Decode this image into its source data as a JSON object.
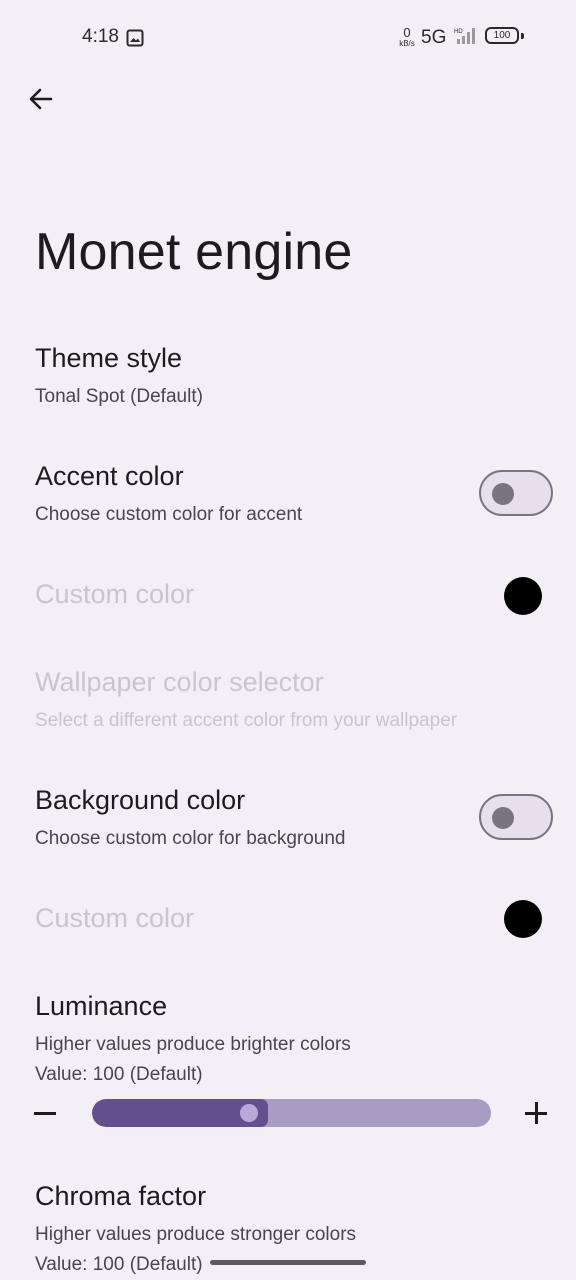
{
  "status_bar": {
    "time": "4:18",
    "net_speed": "0",
    "net_unit": "kB/s",
    "network": "5G",
    "signal_label": "HD",
    "battery": "100"
  },
  "page_title": "Monet engine",
  "prefs": {
    "theme_style": {
      "title": "Theme style",
      "summary": "Tonal Spot (Default)"
    },
    "accent_color": {
      "title": "Accent color",
      "summary": "Choose custom color for accent",
      "enabled": false
    },
    "custom_color_1": {
      "title": "Custom color",
      "color": "#000000"
    },
    "wallpaper_selector": {
      "title": "Wallpaper color selector",
      "summary": "Select a different accent color from your wallpaper"
    },
    "background_color": {
      "title": "Background color",
      "summary": "Choose custom color for background",
      "enabled": false
    },
    "custom_color_2": {
      "title": "Custom color",
      "color": "#000000"
    },
    "luminance": {
      "title": "Luminance",
      "summary": "Higher values produce brighter colors",
      "value": "Value: 100 (Default)",
      "level": 0.4
    },
    "chroma": {
      "title": "Chroma factor",
      "summary": "Higher values produce stronger colors",
      "value": "Value: 100 (Default)"
    }
  },
  "colors": {
    "background": "#f4eff7",
    "accent": "#64508f",
    "track": "#a99cc3",
    "disabled_text": "#c9c5cc"
  }
}
